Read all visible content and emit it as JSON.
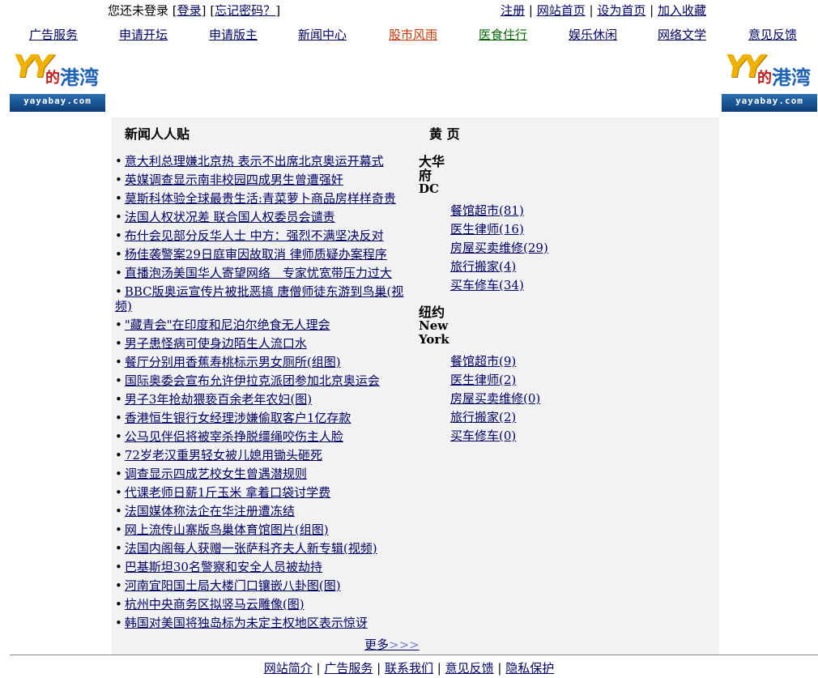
{
  "topbar": {
    "login_prefix": "您还未登录",
    "login_link": "登录",
    "forgot_link": "忘记密码？",
    "links": [
      "注册",
      "网站首页",
      "设为首页",
      "加入收藏"
    ]
  },
  "nav": [
    {
      "label": "广告服务",
      "color": "#000066"
    },
    {
      "label": "申请开坛",
      "color": "#000066"
    },
    {
      "label": "申请版主",
      "color": "#000066"
    },
    {
      "label": "新闻中心",
      "color": "#000066"
    },
    {
      "label": "股市风雨",
      "color": "#cc3300"
    },
    {
      "label": "医食住行",
      "color": "#006600"
    },
    {
      "label": "娱乐休闲",
      "color": "#000066"
    },
    {
      "label": "网络文学",
      "color": "#000066"
    },
    {
      "label": "意见反馈",
      "color": "#000066"
    }
  ],
  "logo": {
    "brand_yy": "YY",
    "brand_de": "的",
    "brand_gw": "港湾",
    "domain": "yayabay.com"
  },
  "news": {
    "heading": "新闻人人贴",
    "items": [
      "意大利总理嫌北京热 表示不出席北京奥运开幕式",
      "英媒调查显示南非校园四成男生曾遭强奸",
      "莫斯科体验全球最贵生活:青菜萝卜商品房样样奇贵",
      "法国人权状况差 联合国人权委员会谴责",
      "布什会见部分反华人士 中方：强烈不满坚决反对",
      "杨佳袭警案29日庭审因故取消 律师质疑办案程序",
      "直播泡汤美国华人寄望网络　专家忧宽带压力过大",
      "BBC版奥运宣传片被批恶搞 唐僧师徒东游到鸟巢(视频)",
      "\"藏青会\"在印度和尼泊尔绝食无人理会",
      "男子患怪病可使身边陌生人流口水",
      "餐厅分别用香蕉寿桃标示男女厕所(组图)",
      "国际奥委会宣布允许伊拉克派团参加北京奥运会",
      "男子3年抢劫猥亵百余老年农妇(图)",
      "香港恒生银行女经理涉嫌偷取客户1亿存款",
      "公马见伴侣将被宰杀挣脱缰绳咬伤主人脸",
      "72岁老汉重男轻女被儿媳用锄头砸死",
      "调查显示四成艺校女生曾遇潜规则",
      "代课老师日薪1斤玉米 拿着口袋讨学费",
      "法国媒体称法企在华注册遭冻结",
      "网上流传山寨版鸟巢体育馆图片(组图)",
      "法国内阁每人获赠一张萨科齐夫人新专辑(视频)",
      "巴基斯坦30名警察和安全人员被劫持",
      "河南宜阳国土局大楼门口镶嵌八卦图(图)",
      "杭州中央商务区拟竖马云雕像(图)",
      "韩国对美国将独岛标为未定主权地区表示惊讶"
    ],
    "more_label": "更多",
    "more_arrows": ">>>"
  },
  "yellow_pages": {
    "heading": "黄 页",
    "cities": [
      {
        "name_cn": "大华府",
        "name_en": "DC",
        "items": [
          "餐馆超市(81)",
          "医生律师(16)",
          "房屋买卖维修(29)",
          "旅行搬家(4)",
          "买车修车(34)"
        ]
      },
      {
        "name_cn": "纽约",
        "name_en": "New York",
        "items": [
          "餐馆超市(9)",
          "医生律师(2)",
          "房屋买卖维修(0)",
          "旅行搬家(2)",
          "买车修车(0)"
        ]
      }
    ]
  },
  "footer": {
    "links": [
      "网站简介",
      "广告服务",
      "联系我们",
      "意见反馈",
      "隐私保护"
    ]
  }
}
